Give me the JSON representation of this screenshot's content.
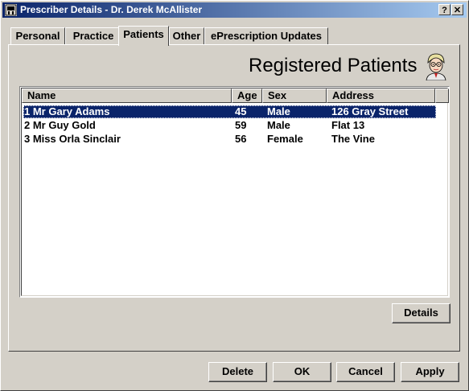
{
  "window": {
    "title": "Prescriber Details - Dr. Derek McAllister",
    "help_label": "?",
    "close_label": "✕"
  },
  "tabs": [
    {
      "label": "Personal"
    },
    {
      "label": "Practice"
    },
    {
      "label": "Patients",
      "active": true
    },
    {
      "label": "Other"
    },
    {
      "label": "ePrescription Updates"
    }
  ],
  "panel": {
    "heading": "Registered Patients",
    "columns": [
      "Name",
      "Age",
      "Sex",
      "Address"
    ],
    "rows": [
      {
        "name": "1 Mr Gary Adams",
        "age": "45",
        "sex": "Male",
        "address": "126 Gray Street",
        "selected": true
      },
      {
        "name": "2 Mr Guy Gold",
        "age": "59",
        "sex": "Male",
        "address": "Flat 13"
      },
      {
        "name": "3 Miss Orla Sinclair",
        "age": "56",
        "sex": "Female",
        "address": "The Vine"
      }
    ],
    "details_label": "Details"
  },
  "footer": {
    "delete_label": "Delete",
    "ok_label": "OK",
    "cancel_label": "Cancel",
    "apply_label": "Apply"
  },
  "colors": {
    "titlebar_start": "#0a246a",
    "titlebar_end": "#a6caf0",
    "selection": "#0a246a",
    "face": "#d4d0c8"
  }
}
